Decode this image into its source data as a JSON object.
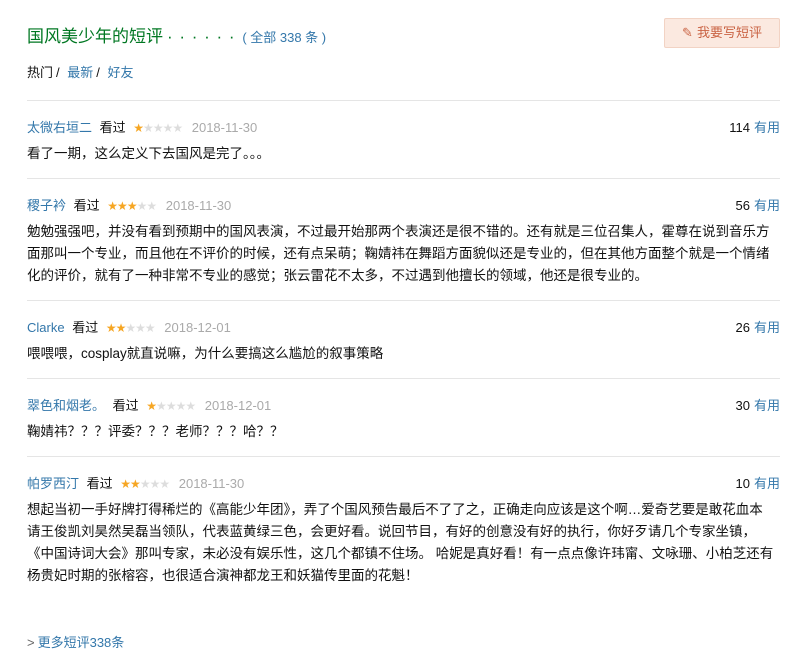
{
  "header": {
    "title": "国风美少年的短评",
    "dots": "· · · · · ·",
    "count_label": "( 全部 338 条 )",
    "write_button": "我要写短评"
  },
  "filters": {
    "hot": "热门",
    "latest": "最新",
    "friends": "好友"
  },
  "watched_label": "看过",
  "useful_label": "有用",
  "comments": [
    {
      "user": "太微右垣二",
      "rating": 1,
      "date": "2018-11-30",
      "votes": "114",
      "text": "看了一期，这么定义下去国风是完了。。。"
    },
    {
      "user": "稷子衿",
      "rating": 3,
      "date": "2018-11-30",
      "votes": "56",
      "text": "勉勉强强吧，并没有看到预期中的国风表演，不过最开始那两个表演还是很不错的。还有就是三位召集人，霍尊在说到音乐方面那叫一个专业，而且他在不评价的时候，还有点呆萌；鞠婧祎在舞蹈方面貌似还是专业的，但在其他方面整个就是一个情绪化的评价，就有了一种非常不专业的感觉；张云雷花不太多，不过遇到他擅长的领域，他还是很专业的。"
    },
    {
      "user": "Clarke",
      "rating": 2,
      "date": "2018-12-01",
      "votes": "26",
      "text": "喂喂喂，cosplay就直说嘛，为什么要搞这么尴尬的叙事策略"
    },
    {
      "user": "翠色和烟老。",
      "rating": 1,
      "date": "2018-12-01",
      "votes": "30",
      "text": "鞠婧祎？？？评委？？？老师？？？哈？？"
    },
    {
      "user": "帕罗西汀",
      "rating": 2,
      "date": "2018-11-30",
      "votes": "10",
      "text": "想起当初一手好牌打得稀烂的《高能少年团》，弄了个国风预告最后不了了之，正确走向应该是这个啊…爱奇艺要是敢花血本请王俊凯刘昊然吴磊当领队，代表蓝黄绿三色，会更好看。说回节目，有好的创意没有好的执行，你好歹请几个专家坐镇，《中国诗词大会》那叫专家，未必没有娱乐性，这几个都镇不住场。 哈妮是真好看！有一点点像许玮甯、文咏珊、小柏芝还有杨贵妃时期的张榕容，也很适合演神都龙王和妖猫传里面的花魁！"
    }
  ],
  "more_link": "更多短评338条",
  "colors": {
    "accent_green": "#007722",
    "link_blue": "#3377aa",
    "star": "#f6a623",
    "button_bg": "#fbe9e0"
  }
}
